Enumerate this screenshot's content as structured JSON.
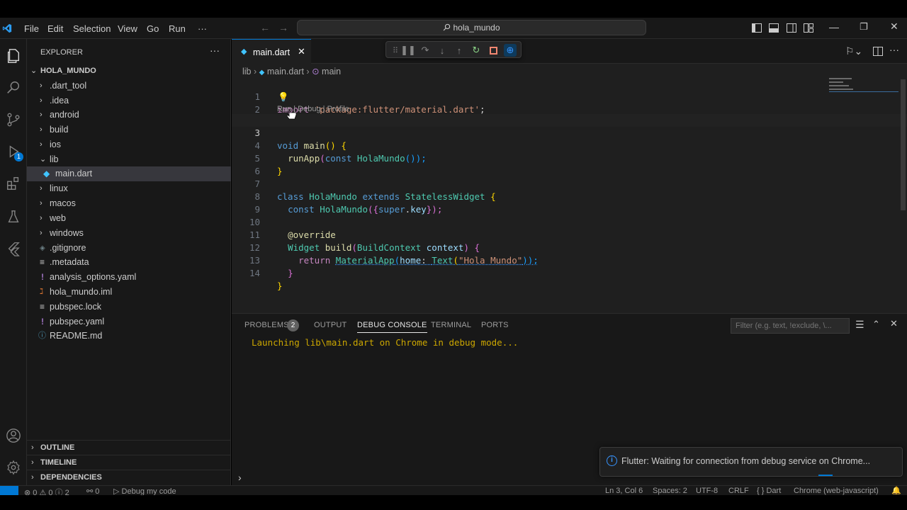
{
  "menu": [
    "File",
    "Edit",
    "Selection",
    "View",
    "Go",
    "Run",
    "···"
  ],
  "title_search": "hola_mundo",
  "explorer": {
    "header": "EXPLORER",
    "root": "HOLA_MUNDO",
    "items": [
      {
        "label": ".dart_tool",
        "type": "folder"
      },
      {
        "label": ".idea",
        "type": "folder"
      },
      {
        "label": "android",
        "type": "folder"
      },
      {
        "label": "build",
        "type": "folder"
      },
      {
        "label": "ios",
        "type": "folder"
      },
      {
        "label": "lib",
        "type": "folder-open"
      },
      {
        "label": "main.dart",
        "type": "dart-file"
      },
      {
        "label": "linux",
        "type": "folder"
      },
      {
        "label": "macos",
        "type": "folder"
      },
      {
        "label": "web",
        "type": "folder"
      },
      {
        "label": "windows",
        "type": "folder"
      },
      {
        "label": ".gitignore",
        "type": "file"
      },
      {
        "label": ".metadata",
        "type": "file"
      },
      {
        "label": "analysis_options.yaml",
        "type": "yaml"
      },
      {
        "label": "hola_mundo.iml",
        "type": "iml"
      },
      {
        "label": "pubspec.lock",
        "type": "file"
      },
      {
        "label": "pubspec.yaml",
        "type": "yaml"
      },
      {
        "label": "README.md",
        "type": "info"
      }
    ],
    "sections": [
      "OUTLINE",
      "TIMELINE",
      "DEPENDENCIES"
    ]
  },
  "activity_badge": "1",
  "tab": {
    "label": "main.dart"
  },
  "breadcrumb": {
    "folder": "lib",
    "file": "main.dart",
    "symbol": "main"
  },
  "codelens": {
    "run": "Run",
    "debug": "Debug",
    "profile": "Profile",
    "sep": " | "
  },
  "code": {
    "l1_kw": "import",
    "l1_str": "'package:flutter/material.dart'",
    "l1_end": ";",
    "l3_kw": "void",
    "l3_fn": "main",
    "l3_rest": "() {",
    "l4_fn": "runApp",
    "l4_kw": "const",
    "l4_cls": "HolaMundo",
    "l4_rest": "());",
    "l5": "}",
    "l7_kw1": "class",
    "l7_cls": "HolaMundo",
    "l7_kw2": "extends",
    "l7_cls2": "StatelessWidget",
    "l7_br": "{",
    "l8_kw": "const",
    "l8_cls": "HolaMundo",
    "l8_p1": "({",
    "l8_var": "super",
    "l8_dot": ".",
    "l8_key": "key",
    "l8_p2": "});",
    "l10": "@override",
    "l11_cls": "Widget",
    "l11_fn": "build",
    "l11_cls2": "BuildContext",
    "l11_var": "context",
    "l11_p": ") {",
    "l12_kw": "return",
    "l12_cls": "MaterialApp",
    "l12_var": "home",
    "l12_cls2": "Text",
    "l12_str": "\"Hola Mundo\"",
    "l12_end": "));",
    "l13": "}",
    "l14": "}",
    "line_numbers": [
      "1",
      "2",
      "3",
      "4",
      "5",
      "6",
      "7",
      "8",
      "9",
      "10",
      "11",
      "12",
      "13",
      "14"
    ]
  },
  "panel": {
    "tabs": [
      "PROBLEMS",
      "OUTPUT",
      "DEBUG CONSOLE",
      "TERMINAL",
      "PORTS"
    ],
    "problems_count": "2",
    "filter_placeholder": "Filter (e.g. text, !exclude, \\...",
    "console_output": "Launching lib\\main.dart on Chrome in debug mode..."
  },
  "notification": "Flutter: Waiting for connection from debug service on Chrome...",
  "statusbar": {
    "errors": "0",
    "warnings": "0",
    "info": "2",
    "ports": "0",
    "debug": "Debug my code",
    "position": "Ln 3, Col 6",
    "spaces": "Spaces: 2",
    "encoding": "UTF-8",
    "eol": "CRLF",
    "language": "Dart",
    "device": "Chrome (web-javascript)"
  },
  "colors": {
    "accent": "#0078d4",
    "bg": "#1f1f1f",
    "sidebar": "#181818"
  }
}
